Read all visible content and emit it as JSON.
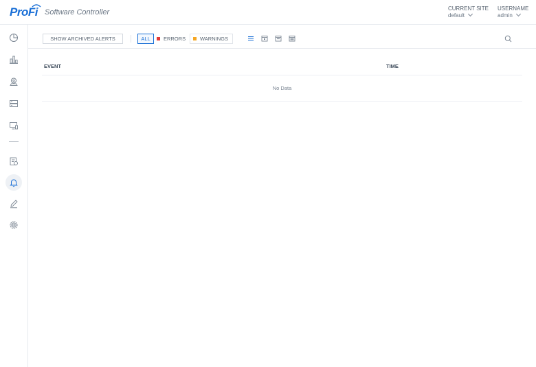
{
  "header": {
    "logo_text": "ProFi",
    "app_title": "Software Controller",
    "site": {
      "label": "CURRENT SITE",
      "value": "default"
    },
    "user": {
      "label": "USERNAME",
      "value": "admin"
    }
  },
  "sidebar": {
    "items": [
      {
        "name": "dashboard",
        "icon": "pie-chart-icon"
      },
      {
        "name": "statistics",
        "icon": "bar-chart-icon"
      },
      {
        "name": "map",
        "icon": "map-pin-icon"
      },
      {
        "name": "devices",
        "icon": "server-icon"
      },
      {
        "name": "clients",
        "icon": "monitor-icon"
      },
      {
        "name": "insights",
        "icon": "report-icon"
      },
      {
        "name": "alerts",
        "icon": "bell-icon",
        "active": true
      },
      {
        "name": "events",
        "icon": "edit-icon"
      },
      {
        "name": "settings",
        "icon": "gear-icon"
      }
    ]
  },
  "toolbar": {
    "archived_label": "SHOW ARCHIVED ALERTS",
    "filters": {
      "all": "ALL",
      "errors": "ERRORS",
      "warnings": "WARNINGS"
    },
    "colors": {
      "accent": "#1a6fd6",
      "error": "#e53935",
      "warning": "#f5a623"
    },
    "date_icons": [
      "list-icon",
      "calendar-day-icon",
      "calendar-week-icon",
      "calendar-month-icon"
    ]
  },
  "table": {
    "columns": [
      "EVENT",
      "TIME"
    ],
    "empty_text": "No Data"
  }
}
